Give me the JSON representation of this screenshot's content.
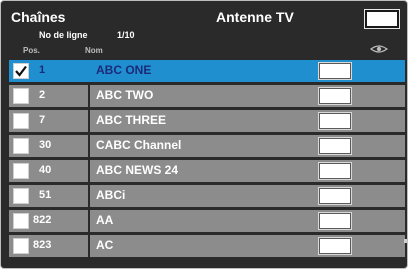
{
  "header": {
    "title": "Chaînes",
    "source": "Antenne TV",
    "row_label": "No de ligne",
    "row_value": "1/10"
  },
  "columns": {
    "pos": "Pos.",
    "name": "Nom"
  },
  "icons": {
    "column_icon": "eye-icon",
    "check_icon": "checkmark-icon"
  },
  "colors": {
    "selected_row": "#1f8fd0",
    "selected_text": "#1c2a7a",
    "row": "#8c8c8c",
    "background": "#2a2a2a"
  },
  "channels": [
    {
      "pos": "1",
      "name": "ABC ONE",
      "checked": true,
      "selected": true
    },
    {
      "pos": "2",
      "name": "ABC TWO",
      "checked": false,
      "selected": false
    },
    {
      "pos": "7",
      "name": "ABC THREE",
      "checked": false,
      "selected": false
    },
    {
      "pos": "30",
      "name": "CABC Channel",
      "checked": false,
      "selected": false
    },
    {
      "pos": "40",
      "name": "ABC NEWS 24",
      "checked": false,
      "selected": false
    },
    {
      "pos": "51",
      "name": "ABCi",
      "checked": false,
      "selected": false
    },
    {
      "pos": "822",
      "name": "AA",
      "checked": false,
      "selected": false
    },
    {
      "pos": "823",
      "name": "AC",
      "checked": false,
      "selected": false
    }
  ]
}
